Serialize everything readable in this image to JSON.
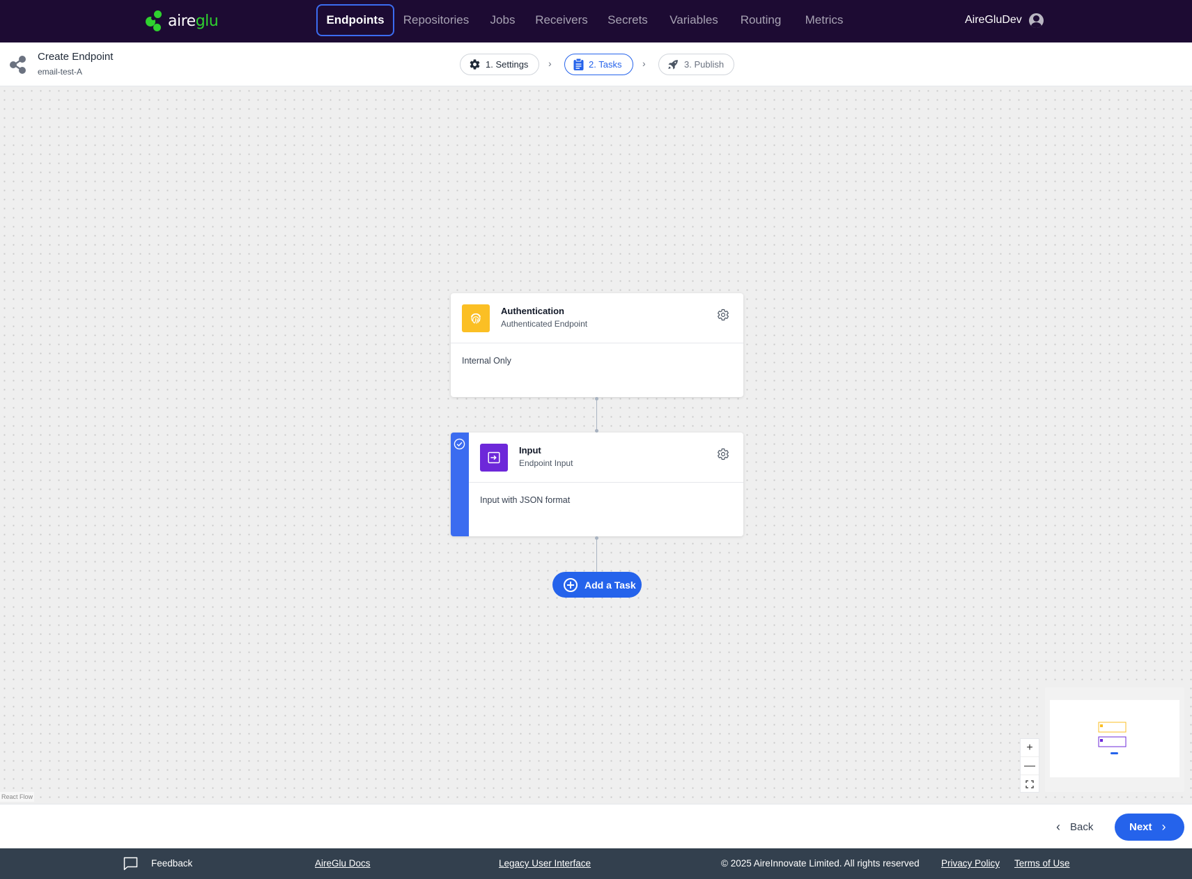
{
  "brand": {
    "logo_prefix": "aire",
    "logo_suffix": "glu",
    "accent": "#2fd12f"
  },
  "nav": {
    "items": [
      {
        "label": "Endpoints",
        "active": true
      },
      {
        "label": "Repositories"
      },
      {
        "label": "Jobs"
      },
      {
        "label": "Receivers"
      },
      {
        "label": "Secrets"
      },
      {
        "label": "Variables"
      },
      {
        "label": "Routing"
      },
      {
        "label": "Metrics"
      }
    ],
    "user": "AireGluDev"
  },
  "header": {
    "title": "Create Endpoint",
    "subtitle": "email-test-A",
    "icon": "share-icon",
    "steps": [
      {
        "label": "1. Settings",
        "icon": "gear-icon",
        "state": "done"
      },
      {
        "label": "2. Tasks",
        "icon": "clipboard-icon",
        "state": "active"
      },
      {
        "label": "3. Publish",
        "icon": "rocket-icon",
        "state": "pending"
      }
    ]
  },
  "flow": {
    "nodes": [
      {
        "title": "Authentication",
        "subtitle": "Authenticated Endpoint",
        "description": "Internal Only",
        "icon": "fingerprint-icon",
        "color": "#fbbf24",
        "selected": false
      },
      {
        "title": "Input",
        "subtitle": "Endpoint Input",
        "description": "Input with JSON format",
        "icon": "input-icon",
        "color": "#6d28d9",
        "selected": true
      }
    ],
    "add_task_label": "Add a Task",
    "attribution": "React Flow",
    "controls": {
      "zoom_in": "+",
      "zoom_out": "—"
    }
  },
  "actions": {
    "back_label": "Back",
    "next_label": "Next",
    "primary_color": "#2563eb"
  },
  "footer": {
    "feedback": "Feedback",
    "docs": "AireGlu Docs",
    "legacy": "Legacy User Interface",
    "copyright": "© 2025 AireInnovate Limited. All rights reserved",
    "privacy": "Privacy Policy",
    "terms": "Terms of Use"
  }
}
